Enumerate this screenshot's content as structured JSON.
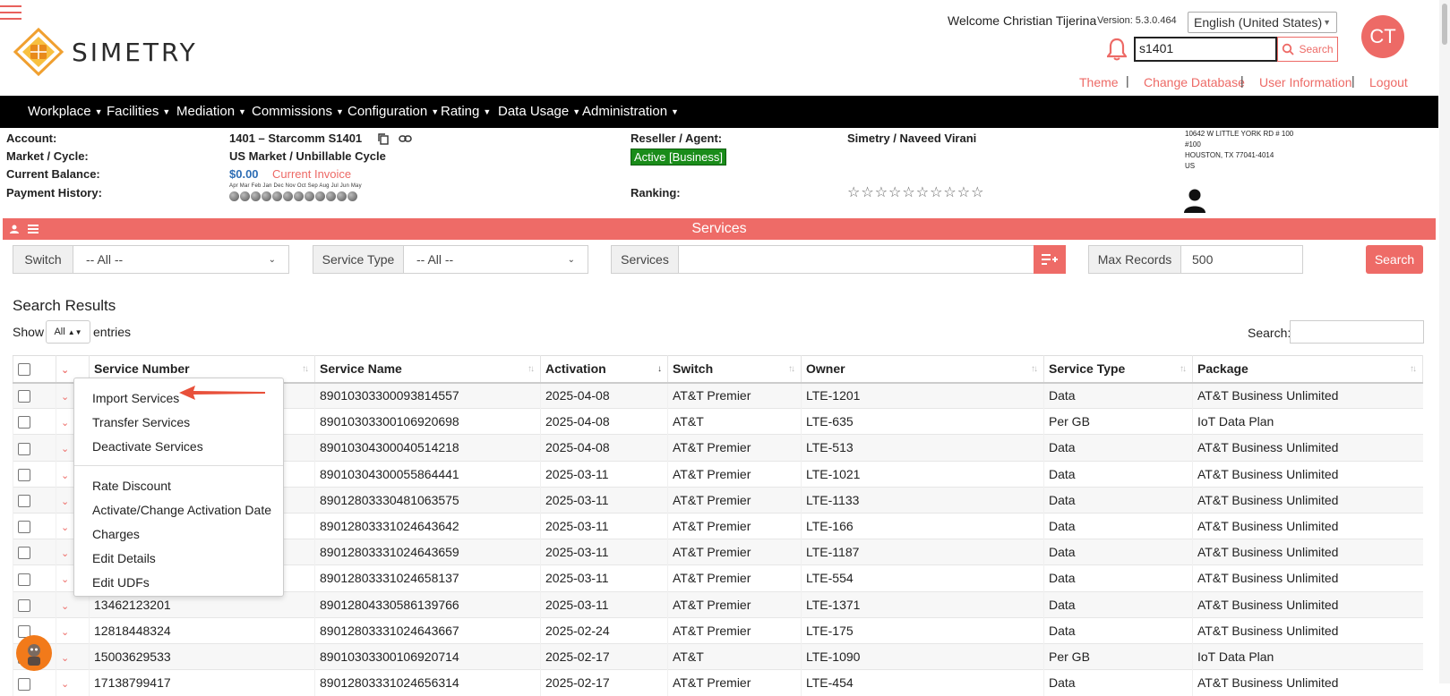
{
  "header": {
    "welcome": "Welcome Christian Tijerina",
    "version": "Version: 5.3.0.464",
    "language": "English (United States)",
    "user_initials": "CT",
    "search_value": "s1401",
    "search_label": "Search",
    "brand": "SIMETRY",
    "links": {
      "theme": "Theme",
      "change_db": "Change Database",
      "user_info": "User Information",
      "logout": "Logout"
    },
    "accent": "#ee6b67"
  },
  "nav": [
    "Workplace",
    "Facilities",
    "Mediation",
    "Commissions",
    "Configuration",
    "Rating",
    "Data Usage",
    "Administration"
  ],
  "account": {
    "account_label": "Account:",
    "account_value": "1401 – Starcomm  S1401",
    "market_label": "Market / Cycle:",
    "market_value": "US Market / Unbillable Cycle",
    "balance_label": "Current Balance:",
    "balance_value": "$0.00",
    "invoice_link": "Current Invoice",
    "payment_label": "Payment History:",
    "payment_months": "Apr Mar Feb Jan  Dec Nov Oct  Sep Aug Jul   Jun  May",
    "reseller_label": "Reseller / Agent:",
    "reseller_value": "Simetry / Naveed Virani",
    "status": "Active [Business]",
    "ranking_label": "Ranking:",
    "stars": "☆☆☆☆☆☆☆☆☆☆",
    "address1": "10642 W LITTLE YORK RD # 100",
    "address2": "#100",
    "address3": "HOUSTON, TX 77041-4014",
    "address4": "US"
  },
  "services": {
    "title": "Services",
    "switch_label": "Switch",
    "switch_value": "-- All --",
    "type_label": "Service Type",
    "type_value": "-- All --",
    "services_label": "Services",
    "max_label": "Max Records",
    "max_value": "500",
    "search_label": "Search"
  },
  "results": {
    "title": "Search Results",
    "show": "Show",
    "show_value": "All",
    "entries": "entries",
    "search": "Search:",
    "columns": [
      "Service Number",
      "Service Name",
      "Activation",
      "Switch",
      "Owner",
      "Service Type",
      "Package"
    ],
    "rows": [
      [
        "",
        "89010303300093814557",
        "2025-04-08",
        "AT&T Premier",
        "LTE-1201",
        "Data",
        "AT&T Business Unlimited"
      ],
      [
        "",
        "89010303300106920698",
        "2025-04-08",
        "AT&T",
        "LTE-635",
        "Per GB",
        "IoT Data Plan"
      ],
      [
        "",
        "89010304300040514218",
        "2025-04-08",
        "AT&T Premier",
        "LTE-513",
        "Data",
        "AT&T Business Unlimited"
      ],
      [
        "",
        "89010304300055864441",
        "2025-03-11",
        "AT&T Premier",
        "LTE-1021",
        "Data",
        "AT&T Business Unlimited"
      ],
      [
        "",
        "89012803330481063575",
        "2025-03-11",
        "AT&T Premier",
        "LTE-1133",
        "Data",
        "AT&T Business Unlimited"
      ],
      [
        "",
        "89012803331024643642",
        "2025-03-11",
        "AT&T Premier",
        "LTE-166",
        "Data",
        "AT&T Business Unlimited"
      ],
      [
        "",
        "89012803331024643659",
        "2025-03-11",
        "AT&T Premier",
        "LTE-1187",
        "Data",
        "AT&T Business Unlimited"
      ],
      [
        "",
        "89012803331024658137",
        "2025-03-11",
        "AT&T Premier",
        "LTE-554",
        "Data",
        "AT&T Business Unlimited"
      ],
      [
        "13462123201",
        "89012804330586139766",
        "2025-03-11",
        "AT&T Premier",
        "LTE-1371",
        "Data",
        "AT&T Business Unlimited"
      ],
      [
        "12818448324",
        "89012803331024643667",
        "2025-02-24",
        "AT&T Premier",
        "LTE-175",
        "Data",
        "AT&T Business Unlimited"
      ],
      [
        "15003629533",
        "89010303300106920714",
        "2025-02-17",
        "AT&T",
        "LTE-1090",
        "Per GB",
        "IoT Data Plan"
      ],
      [
        "17138799417",
        "89012803331024656314",
        "2025-02-17",
        "AT&T Premier",
        "LTE-454",
        "Data",
        "AT&T Business Unlimited"
      ]
    ]
  },
  "menu": {
    "group1": [
      "Import Services",
      "Transfer Services",
      "Deactivate Services"
    ],
    "group2": [
      "Rate Discount",
      "Activate/Change Activation Date",
      "Charges",
      "Edit Details",
      "Edit UDFs"
    ]
  }
}
